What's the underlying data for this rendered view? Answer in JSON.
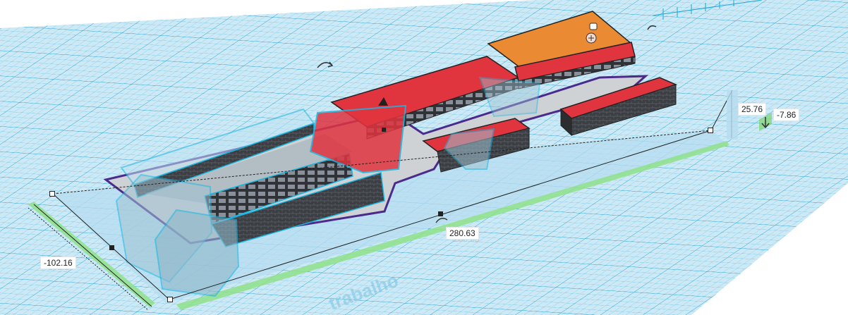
{
  "workplane": {
    "watermark": "trabalho",
    "grid_color": "#1aa7d8",
    "plane_fill": "#c9e9f6"
  },
  "selection": {
    "length": "280.63",
    "length_ghost": "280.63",
    "width": "102.16",
    "width_ghost": "102.16",
    "width_prefix": "-",
    "height": "25.76",
    "elevation": "-7.86"
  },
  "colors": {
    "roof": "#e0343f",
    "roof_orange": "#ea8a32",
    "wall": "#3a3d42",
    "floor": "#d4d6d9",
    "selection_outline": "#1bb6e0",
    "glass": "#8fbfd2",
    "base_outline": "#4b2a8c",
    "elevation_arrow": "#7bd36b"
  },
  "icons": [
    "rotate-arrow-icon",
    "camera-icon",
    "scale-handle-icon",
    "elevation-arrow-icon"
  ]
}
